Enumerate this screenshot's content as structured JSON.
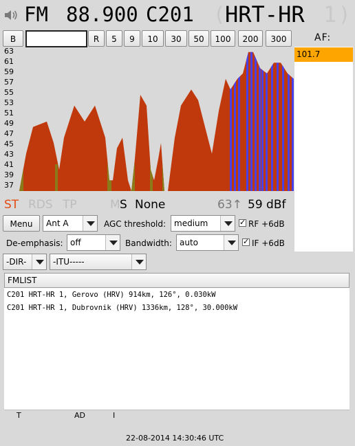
{
  "header": {
    "icon": "speaker-icon",
    "mode": "FM",
    "frequency": "88.900",
    "pi_code": "C201",
    "paren_open": "(",
    "station": "HRT-HR",
    "station_num": "1",
    "paren_close": ")"
  },
  "toolbar": {
    "band_label": "B",
    "freq_input_value": "",
    "r_label": "R",
    "steps": [
      "5",
      "9",
      "10",
      "30",
      "50",
      "100",
      "200",
      "300"
    ]
  },
  "af": {
    "title": "AF:",
    "items": [
      "101.7"
    ]
  },
  "spectrum": {
    "y_ticks": [
      "63",
      "61",
      "59",
      "57",
      "55",
      "53",
      "51",
      "49",
      "47",
      "45",
      "43",
      "41",
      "39",
      "37"
    ],
    "colors": {
      "signal": "#c0390c",
      "stereo": "#4a40e8",
      "weak": "#8a7a1a"
    }
  },
  "status": {
    "st": "ST",
    "rds": "RDS",
    "tp": "TP",
    "m": "M",
    "s": "S",
    "pty": "None",
    "level_small": "63↑",
    "level": "59 dBf",
    "colors": {
      "st_active": "#e34b12",
      "inactive": "#bdbdbd",
      "dim": "#7a7a7a"
    }
  },
  "controls": {
    "menu_label": "Menu",
    "antenna_value": "Ant A",
    "agc_label": "AGC threshold:",
    "agc_value": "medium",
    "rf_label": "RF +6dB",
    "deemph_label": "De-emphasis:",
    "deemph_value": "off",
    "bandwidth_label": "Bandwidth:",
    "bandwidth_value": "auto",
    "if_label": "IF +6dB",
    "dir_value": "-DIR-",
    "itu_value": "-ITU-----"
  },
  "fmlist": {
    "header": "FMLIST",
    "rows": [
      "C201 HRT-HR 1, Gerovo (HRV) 914km, 126°, 0.030kW",
      "C201 HRT-HR 1, Dubrovnik (HRV) 1336km, 128°, 30.000kW"
    ]
  },
  "footer": {
    "t": "T",
    "ad": "AD",
    "i": "I",
    "timestamp": "22-08-2014 14:30:46 UTC"
  }
}
